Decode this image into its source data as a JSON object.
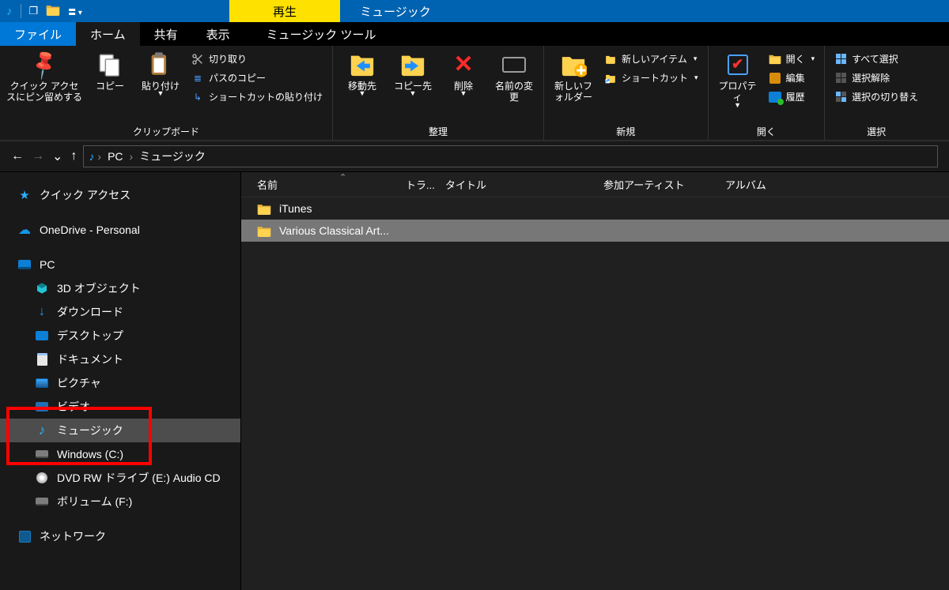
{
  "titlebar": {
    "contextual_tab": "再生",
    "window_title": "ミュージック"
  },
  "tabs": {
    "file": "ファイル",
    "home": "ホーム",
    "share": "共有",
    "view": "表示",
    "music_tools": "ミュージック ツール"
  },
  "ribbon": {
    "clipboard": {
      "pin": "クイック アクセスにピン留めする",
      "copy": "コピー",
      "paste": "貼り付け",
      "cut": "切り取り",
      "copy_path": "パスのコピー",
      "paste_shortcut": "ショートカットの貼り付け",
      "label": "クリップボード"
    },
    "organize": {
      "move_to": "移動先",
      "copy_to": "コピー先",
      "delete": "削除",
      "rename": "名前の変更",
      "label": "整理"
    },
    "new_group": {
      "new_folder": "新しいフォルダー",
      "new_item": "新しいアイテム",
      "shortcut": "ショートカット",
      "label": "新規"
    },
    "open_group": {
      "properties": "プロパティ",
      "open": "開く",
      "edit": "編集",
      "history": "履歴",
      "label": "開く"
    },
    "select_group": {
      "select_all": "すべて選択",
      "select_none": "選択解除",
      "invert": "選択の切り替え",
      "label": "選択"
    }
  },
  "breadcrumbs": {
    "pc": "PC",
    "music": "ミュージック"
  },
  "sidebar": {
    "quick_access": "クイック アクセス",
    "onedrive": "OneDrive - Personal",
    "pc": "PC",
    "items": {
      "objects3d": "3D オブジェクト",
      "downloads": "ダウンロード",
      "desktop": "デスクトップ",
      "documents": "ドキュメント",
      "pictures": "ピクチャ",
      "videos": "ビデオ",
      "music": "ミュージック",
      "windows_c": "Windows (C:)",
      "dvd": "DVD RW ドライブ (E:) Audio CD",
      "volume_f": "ボリューム (F:)"
    },
    "network": "ネットワーク"
  },
  "columns": {
    "name": "名前",
    "track": "トラ...",
    "title": "タイトル",
    "artist": "参加アーティスト",
    "album": "アルバム"
  },
  "rows": [
    {
      "name": "iTunes",
      "selected": false
    },
    {
      "name": "Various Classical Art...",
      "selected": true
    }
  ]
}
